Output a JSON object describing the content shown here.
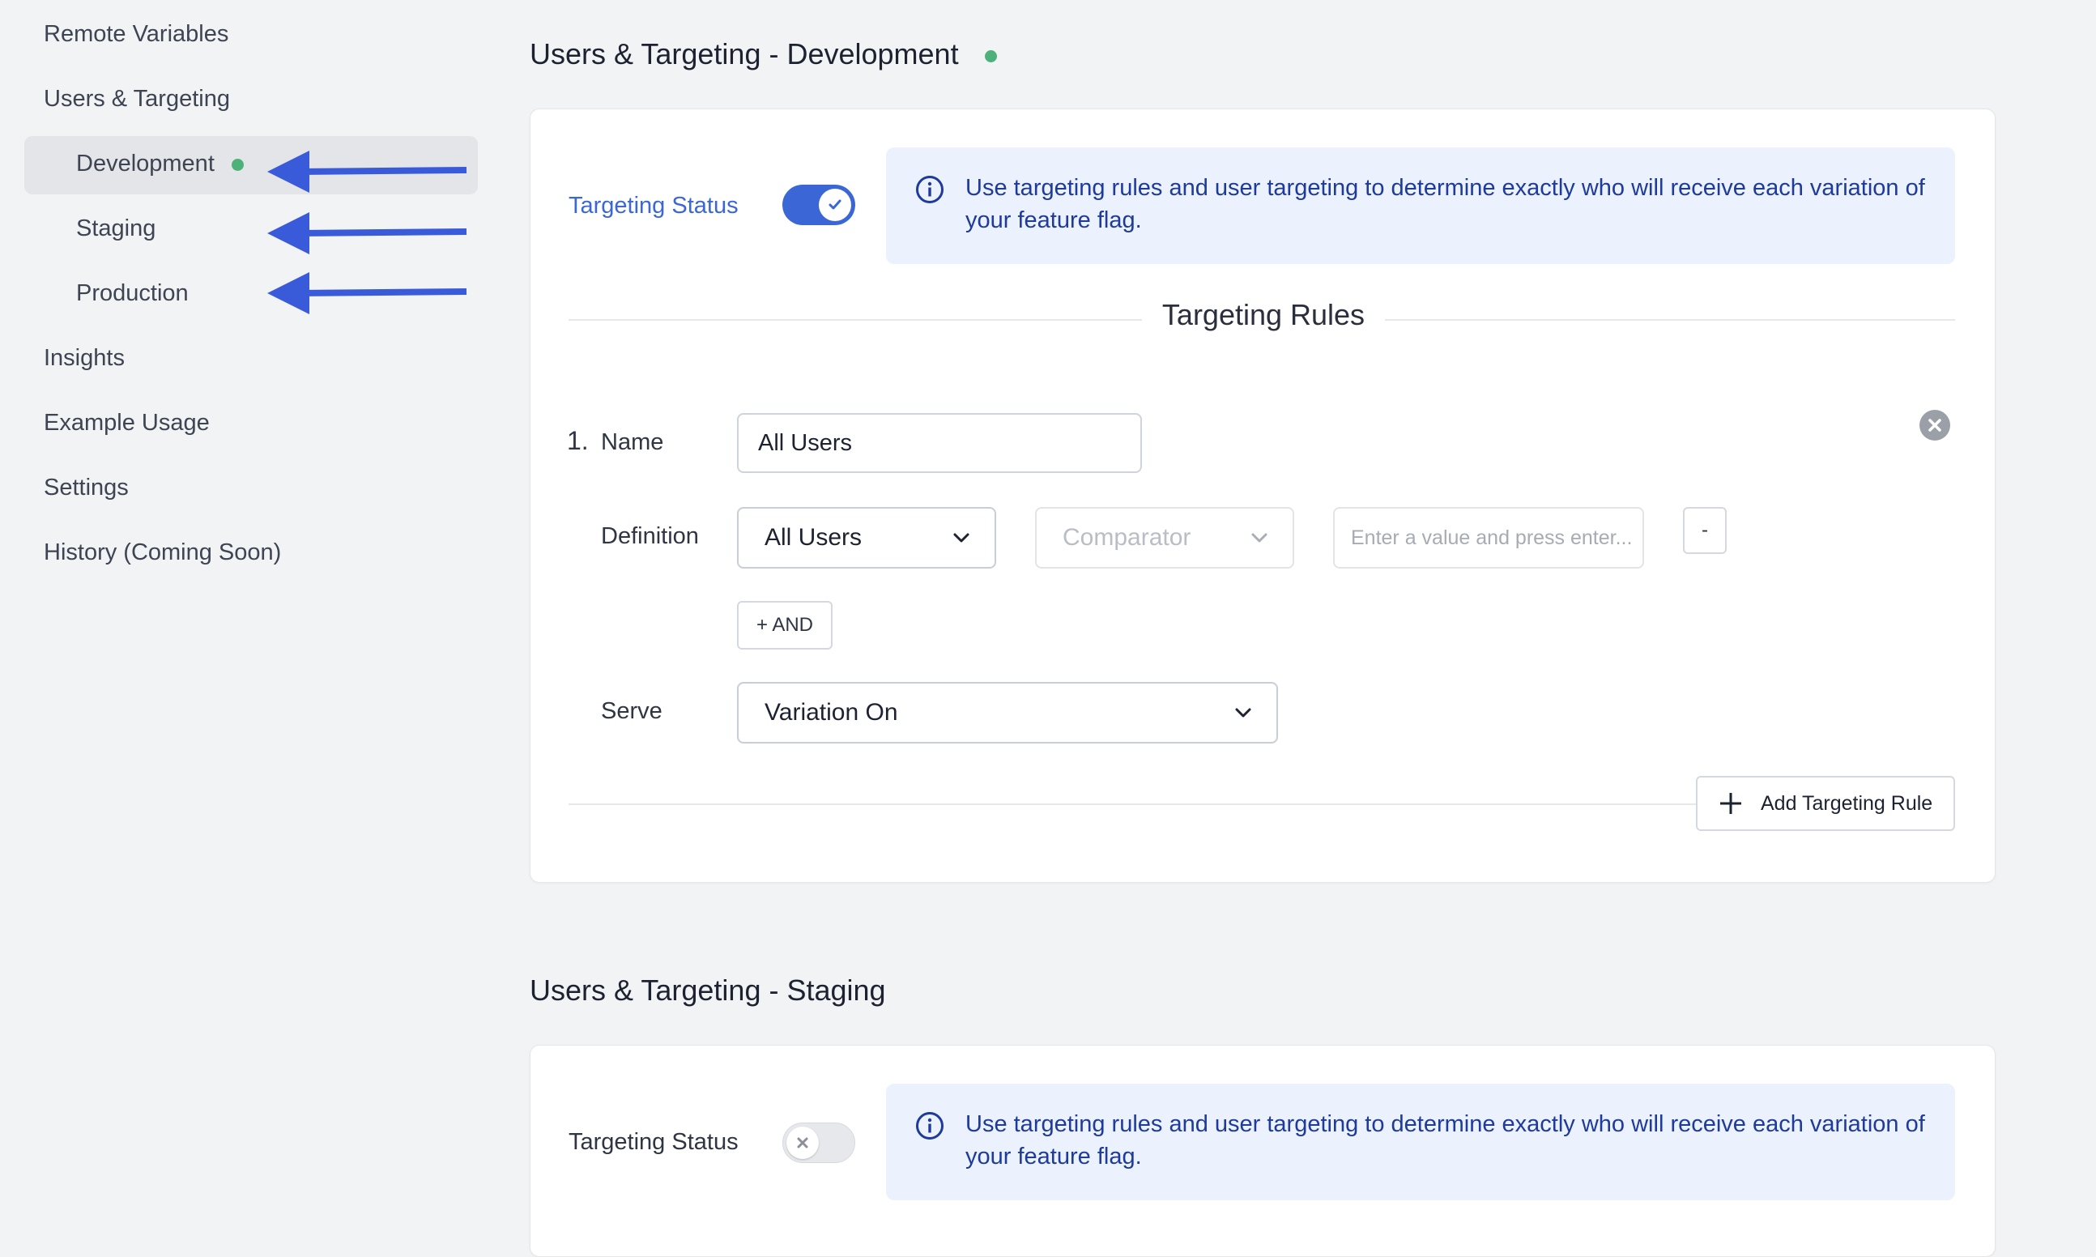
{
  "sidebar": {
    "items": [
      {
        "label": "Remote Variables"
      },
      {
        "label": "Users & Targeting"
      },
      {
        "label": "Development"
      },
      {
        "label": "Staging"
      },
      {
        "label": "Production"
      },
      {
        "label": "Insights"
      },
      {
        "label": "Example Usage"
      },
      {
        "label": "Settings"
      },
      {
        "label": "History (Coming Soon)"
      }
    ]
  },
  "development": {
    "title": "Users & Targeting - Development",
    "targeting_status_label": "Targeting Status",
    "toggle_on": true,
    "info": "Use targeting rules and user targeting to determine exactly who will receive each variation of your feature flag.",
    "rules_title": "Targeting Rules",
    "rule": {
      "number": "1.",
      "name_label": "Name",
      "name_value": "All Users",
      "definition_label": "Definition",
      "definition_value": "All Users",
      "comparator_placeholder": "Comparator",
      "value_placeholder": "Enter a value and press enter...",
      "remove_label": "-",
      "and_label": "+ AND",
      "serve_label": "Serve",
      "serve_value": "Variation On"
    },
    "add_rule_label": "Add Targeting Rule"
  },
  "staging": {
    "title": "Users & Targeting - Staging",
    "targeting_status_label": "Targeting Status",
    "toggle_on": false,
    "info": "Use targeting rules and user targeting to determine exactly who will receive each variation of your feature flag."
  },
  "colors": {
    "accent": "#3b67d6",
    "status_green": "#4db27a",
    "info_bg": "#ebf2fd",
    "info_text": "#1e3a9a",
    "arrow": "#3a5bd9"
  },
  "icons": [
    "info-icon",
    "check-icon",
    "x-icon",
    "chevron-down-icon",
    "plus-icon",
    "close-circle-icon",
    "arrow-left-icon"
  ]
}
